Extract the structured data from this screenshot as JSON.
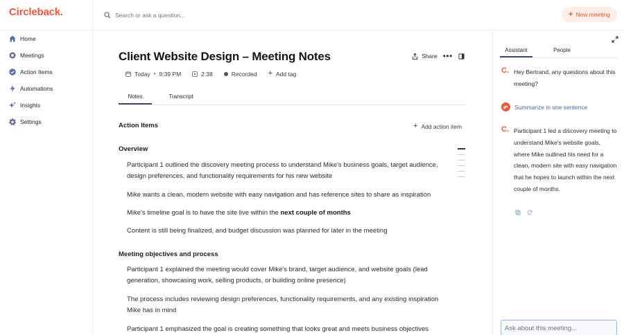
{
  "brand": {
    "logo_text": "Circleback",
    "logo_dot": ".",
    "accent": "#f0563b"
  },
  "search": {
    "placeholder": "Search or ask a question..."
  },
  "new_meeting": {
    "label": "New meeting"
  },
  "sidebar": {
    "items": [
      {
        "label": "Home",
        "icon": "home-icon"
      },
      {
        "label": "Meetings",
        "icon": "meetings-icon"
      },
      {
        "label": "Action Items",
        "icon": "check-circle-icon"
      },
      {
        "label": "Automations",
        "icon": "bolt-icon"
      },
      {
        "label": "Insights",
        "icon": "sparkle-icon"
      },
      {
        "label": "Settings",
        "icon": "gear-icon"
      }
    ]
  },
  "meeting": {
    "title": "Client Website Design – Meeting Notes",
    "date": "Today",
    "time": "9:39 PM",
    "duration": "2:38",
    "status": "Recorded",
    "add_tag": "Add tag"
  },
  "header_actions": {
    "share": "Share"
  },
  "tabs": {
    "notes": "Notes",
    "transcript": "Transcript"
  },
  "action_items": {
    "heading": "Action Items",
    "add_label": "Add action item"
  },
  "overview": {
    "heading": "Overview",
    "points": [
      {
        "pre": "Participant 1 outlined the discovery meeting process to understand Mike's business goals, target audience, design preferences, and functionality requirements for his new website",
        "bold": "",
        "post": ""
      },
      {
        "pre": "Mike wants a clean, modern website with easy navigation and has reference sites to share as inspiration",
        "bold": "",
        "post": ""
      },
      {
        "pre": "Mike's timeline goal is to have the site live within the ",
        "bold": "next couple of months",
        "post": ""
      },
      {
        "pre": "Content is still being finalized, and budget discussion was planned for later in the meeting",
        "bold": "",
        "post": ""
      }
    ]
  },
  "objectives": {
    "heading": "Meeting objectives and process",
    "points": [
      "Participant 1 explained the meeting would cover Mike's brand, target audience, and website goals (lead generation, showcasing work, selling products, or building online presence)",
      "The process includes reviewing design preferences, functionality requirements, and any existing inspiration Mike has in mind",
      "Participant 1 emphasized the goal is creating something that looks great and meets business objectives"
    ]
  },
  "assistant": {
    "tabs": {
      "assistant": "Assistant",
      "people": "People"
    },
    "greeting": "Hey Bertrand, any questions about this meeting?",
    "summarize_label": "Summarize in one sentence",
    "summary": "Participant 1 led a discovery meeting to understand Mike's website goals, where Mike outlined his need for a clean, modern site with easy navigation that he hopes to launch within the next couple of months.",
    "mark": "C.",
    "ask_placeholder": "Ask about this meeting..."
  }
}
